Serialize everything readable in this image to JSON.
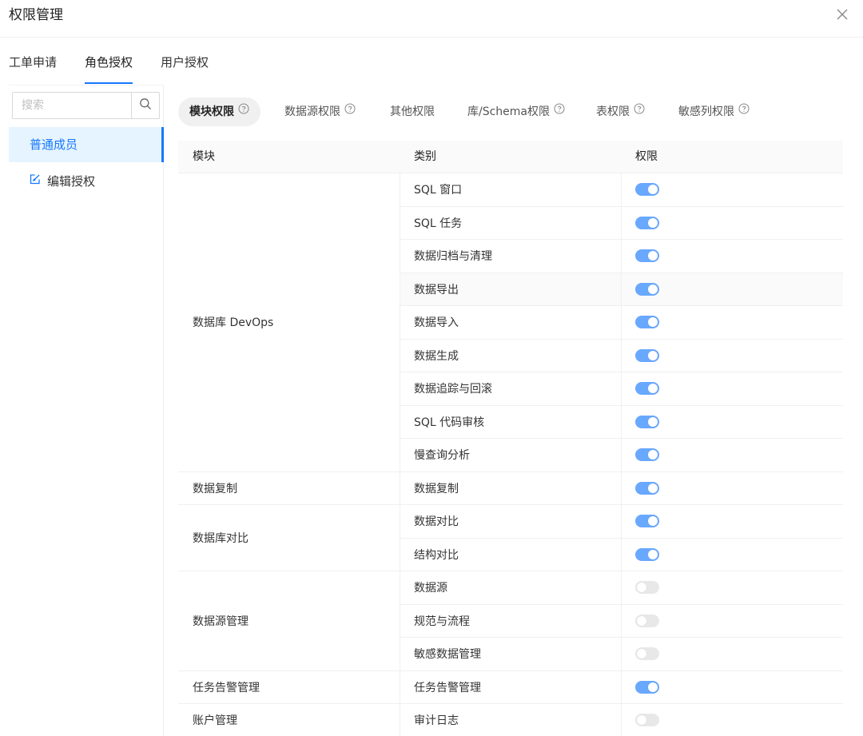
{
  "dialog": {
    "title": "权限管理"
  },
  "main_tabs": [
    {
      "label": "工单申请",
      "active": false
    },
    {
      "label": "角色授权",
      "active": true
    },
    {
      "label": "用户授权",
      "active": false
    }
  ],
  "sidebar": {
    "search_placeholder": "搜索",
    "items": [
      {
        "label": "普通成员",
        "active": true
      },
      {
        "label": "编辑授权",
        "icon": "edit-icon"
      }
    ]
  },
  "sub_tabs": [
    {
      "label": "模块权限",
      "active": true,
      "help": true
    },
    {
      "label": "数据源权限",
      "help": true
    },
    {
      "label": "其他权限",
      "help": false
    },
    {
      "label": "库/Schema权限",
      "help": true
    },
    {
      "label": "表权限",
      "help": true
    },
    {
      "label": "敏感列权限",
      "help": true
    }
  ],
  "table": {
    "headers": [
      "模块",
      "类别",
      "权限"
    ],
    "groups": [
      {
        "module": "数据库 DevOps",
        "rows": [
          {
            "category": "SQL 窗口",
            "enabled": true
          },
          {
            "category": "SQL 任务",
            "enabled": true
          },
          {
            "category": "数据归档与清理",
            "enabled": true
          },
          {
            "category": "数据导出",
            "enabled": true,
            "highlight": true
          },
          {
            "category": "数据导入",
            "enabled": true
          },
          {
            "category": "数据生成",
            "enabled": true
          },
          {
            "category": "数据追踪与回滚",
            "enabled": true
          },
          {
            "category": "SQL 代码审核",
            "enabled": true
          },
          {
            "category": "慢查询分析",
            "enabled": true
          }
        ]
      },
      {
        "module": "数据复制",
        "rows": [
          {
            "category": "数据复制",
            "enabled": true
          }
        ]
      },
      {
        "module": "数据库对比",
        "rows": [
          {
            "category": "数据对比",
            "enabled": true
          },
          {
            "category": "结构对比",
            "enabled": true
          }
        ]
      },
      {
        "module": "数据源管理",
        "rows": [
          {
            "category": "数据源",
            "enabled": false
          },
          {
            "category": "规范与流程",
            "enabled": false
          },
          {
            "category": "敏感数据管理",
            "enabled": false
          }
        ]
      },
      {
        "module": "任务告警管理",
        "rows": [
          {
            "category": "任务告警管理",
            "enabled": true
          }
        ]
      },
      {
        "module": "账户管理",
        "rows": [
          {
            "category": "审计日志",
            "enabled": false
          }
        ]
      }
    ]
  },
  "colors": {
    "accent": "#1677ff",
    "switch_on": "#69a8ff",
    "switch_off": "#e8e8e8"
  }
}
